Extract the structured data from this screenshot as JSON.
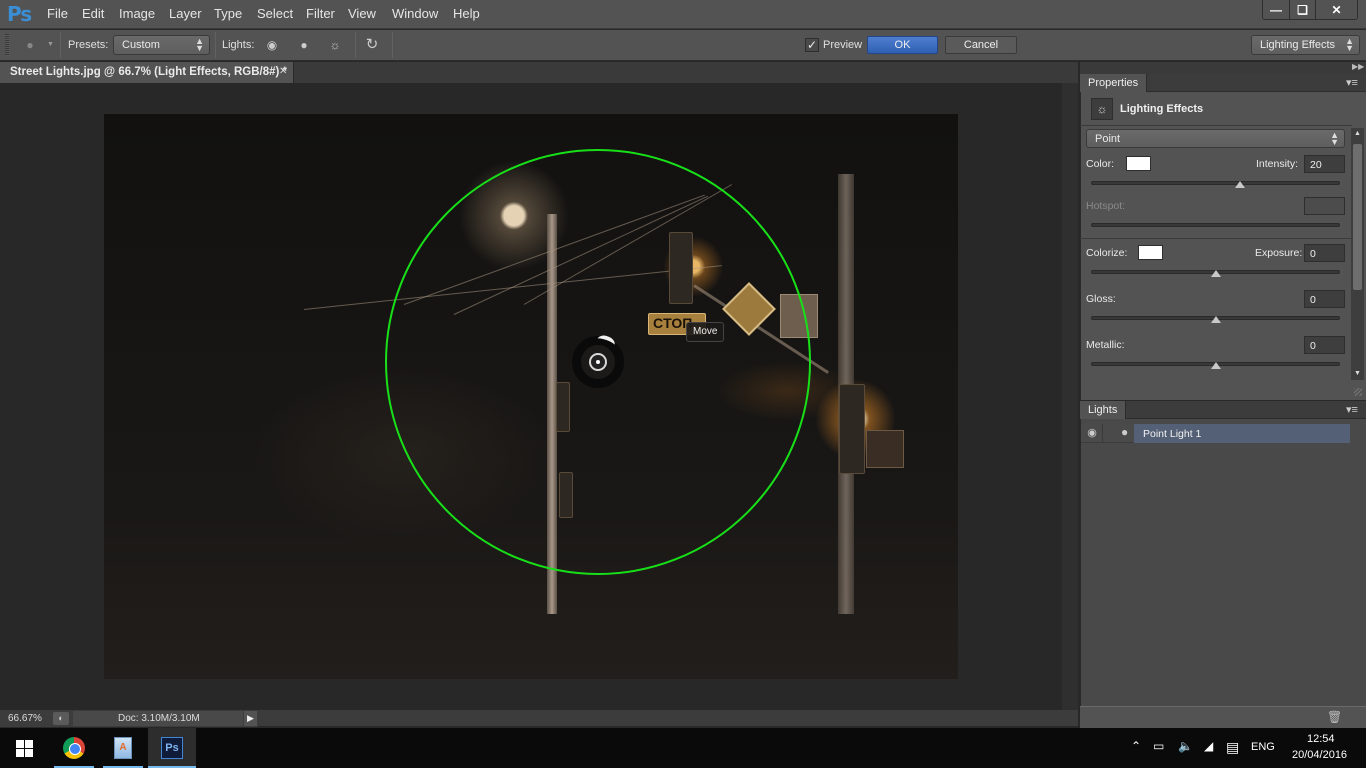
{
  "app": {
    "logo": "Ps",
    "menu": [
      "File",
      "Edit",
      "Image",
      "Layer",
      "Type",
      "Select",
      "Filter",
      "View",
      "Window",
      "Help"
    ],
    "window_controls": {
      "minimize": "minimize",
      "restore": "restore",
      "close": "close"
    }
  },
  "options_bar": {
    "presets_label": "Presets:",
    "presets_value": "Custom",
    "lights_label": "Lights:",
    "light_types": [
      "spot-light",
      "point-light",
      "infinite-light"
    ],
    "preview_label": "Preview",
    "preview_checked": true,
    "ok_label": "OK",
    "cancel_label": "Cancel",
    "workspace_value": "Lighting Effects"
  },
  "document": {
    "tab_title": "Street Lights.jpg @ 66.7% (Light Effects, RGB/8#) *",
    "tooltip": "Move",
    "accent_ring_color": "#18e018"
  },
  "status_bar": {
    "zoom": "66.67%",
    "doc_info": "Doc: 3.10M/3.10M"
  },
  "properties": {
    "tab_label": "Properties",
    "header_title": "Lighting Effects",
    "light_type": "Point",
    "color_label": "Color:",
    "color_value": "#ffffff",
    "intensity_label": "Intensity:",
    "intensity_value": "20",
    "intensity_fraction": 0.6,
    "hotspot_label": "Hotspot:",
    "hotspot_value": "",
    "colorize_label": "Colorize:",
    "colorize_value": "#ffffff",
    "exposure_label": "Exposure:",
    "exposure_value": "0",
    "exposure_fraction": 0.5,
    "gloss_label": "Gloss:",
    "gloss_value": "0",
    "gloss_fraction": 0.5,
    "metallic_label": "Metallic:",
    "metallic_value": "0",
    "metallic_fraction": 0.5
  },
  "lights_panel": {
    "tab_label": "Lights",
    "items": [
      {
        "name": "Point Light 1",
        "visible": true,
        "selected": true
      }
    ]
  },
  "taskbar": {
    "apps": [
      "start",
      "chrome",
      "document-app",
      "photoshop"
    ],
    "language": "ENG",
    "time": "12:54",
    "date": "20/04/2016"
  }
}
